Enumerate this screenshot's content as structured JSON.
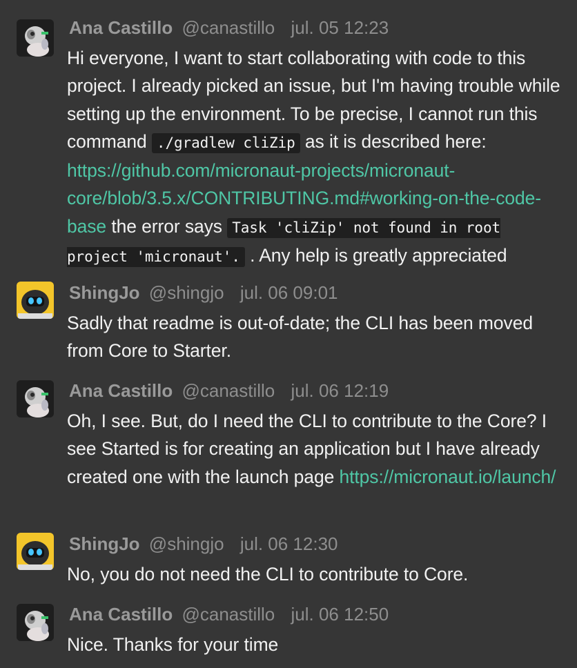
{
  "messages": [
    {
      "author": "Ana Castillo",
      "handle": "@canastillo",
      "time": "jul. 05 12:23",
      "avatar_icon": "robot-figure-avatar",
      "body": {
        "t1": "Hi everyone, I want to start collaborating with code to this project. I already picked an issue, but I'm having trouble while setting up the environment. To be precise, I cannot run this command ",
        "code1": "./gradlew cliZip",
        "t2": " as it is described here: ",
        "link1": "https://github.com/micronaut-projects/micronaut-core/blob/3.5.x/CONTRIBUTING.md#working-on-the-code-base",
        "t3": " the error says ",
        "code2": "Task 'cliZip' not found in root project 'micronaut'.",
        "t4": " . Any help is greatly appreciated"
      }
    },
    {
      "author": "ShingJo",
      "handle": "@shingjo",
      "time": "jul. 06 09:01",
      "avatar_icon": "robot-face-avatar",
      "body": {
        "t1": "Sadly that readme is out-of-date; the CLI has been moved from Core to Starter."
      }
    },
    {
      "author": "Ana Castillo",
      "handle": "@canastillo",
      "time": "jul. 06 12:19",
      "avatar_icon": "robot-figure-avatar",
      "body": {
        "t1": "Oh, I see. But, do I need the CLI to contribute to the Core? I see Started is for creating an application but I have already created one with the launch page ",
        "link1": "https://micronaut.io/launch/"
      }
    },
    {
      "author": "ShingJo",
      "handle": "@shingjo",
      "time": "jul. 06 12:30",
      "avatar_icon": "robot-face-avatar",
      "body": {
        "t1": "No, you do not need the CLI to contribute to Core."
      }
    },
    {
      "author": "Ana Castillo",
      "handle": "@canastillo",
      "time": "jul. 06 12:50",
      "avatar_icon": "robot-figure-avatar",
      "body": {
        "t1": "Nice. Thanks for your time"
      }
    }
  ],
  "colors": {
    "background": "#363636",
    "link": "#4fc7a6",
    "code_background": "#1f1f1f",
    "meta_text": "#8e8e8e",
    "body_text": "#f1f1f1"
  }
}
